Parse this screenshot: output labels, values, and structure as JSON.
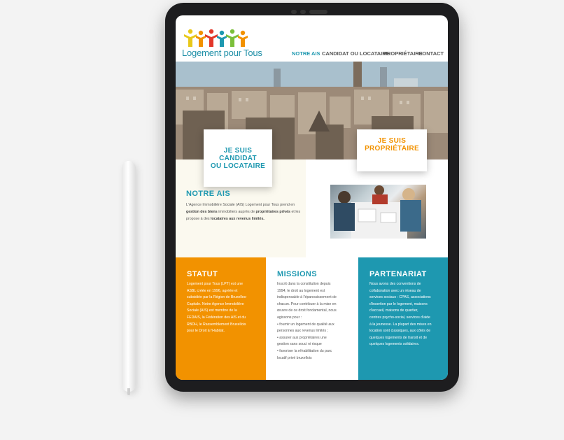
{
  "site": {
    "logo_text": "Logement pour Tous"
  },
  "nav": {
    "items": [
      "NOTRE AIS",
      "CANDIDAT OU LOCATAIRE",
      "PROPRIÉTAIRE",
      "CONTACT"
    ]
  },
  "hero": {
    "card_candidat": [
      "JE SUIS",
      "CANDIDAT",
      "OU LOCATAIRE"
    ],
    "card_proprietaire": [
      "JE SUIS",
      "PROPRIÉTAIRE"
    ]
  },
  "notre_ais": {
    "title": "NOTRE AIS",
    "text_1": "L'Agence Immobilière Sociale (AIS) Logement pour Tous prend en",
    "text_2a": "gestion des biens",
    "text_2b": " immobiliers auprès de ",
    "text_2c": "propriétaires privés",
    "text_2d": " et les",
    "text_3a": "propose à des ",
    "text_3b": "locataires aux revenus limités."
  },
  "statut": {
    "title": "STATUT",
    "lines": [
      "Logement pour Tous (LPT) est une",
      "ASBL créée en 1996, agréée et",
      "subsidiée par la Région de Bruxelles-",
      "Capitale. Notre Agence Immobilière",
      "Sociale (AIS) est membre de la",
      "FEDAIS, la Fédération des AIS et du",
      "RBDH, le Rassemblement Bruxellois",
      "pour le Droit à l'Habitat."
    ]
  },
  "missions": {
    "title": "MISSIONS",
    "lines": [
      "Inscrit dans la constitution depuis",
      "1994, le droit au logement est",
      "indispensable à l'épanouissement de",
      "chacun. Pour contribuer à la mise en",
      "œuvre de ce droit fondamental, nous",
      "agissons pour :",
      "• fournir un logement de qualité aux",
      "personnes aux revenus limités ;",
      "• assurer aux propriétaires une",
      "gestion sans souci ni risque",
      "• favoriser la réhabilitation du parc",
      "locatif privé bruxellois"
    ]
  },
  "partenariat": {
    "title": "PARTENARIAT",
    "lines": [
      "Nous avons des conventions de",
      "collaboration avec un réseau de",
      "services sociaux : CPAS, associations",
      "d'insertion par le logement, maisons",
      "d'accueil, maisons de quartier,",
      "centres psycho-social, services d'aide",
      "à la jeunesse. La plupart des mises en",
      "location sont classiques, aux côtés de",
      "quelques logements de transit et de",
      "quelques logements solidaires."
    ]
  },
  "colors": {
    "teal": "#1e98b0",
    "orange": "#f29200",
    "dark_teal": "#2a7f8f"
  }
}
